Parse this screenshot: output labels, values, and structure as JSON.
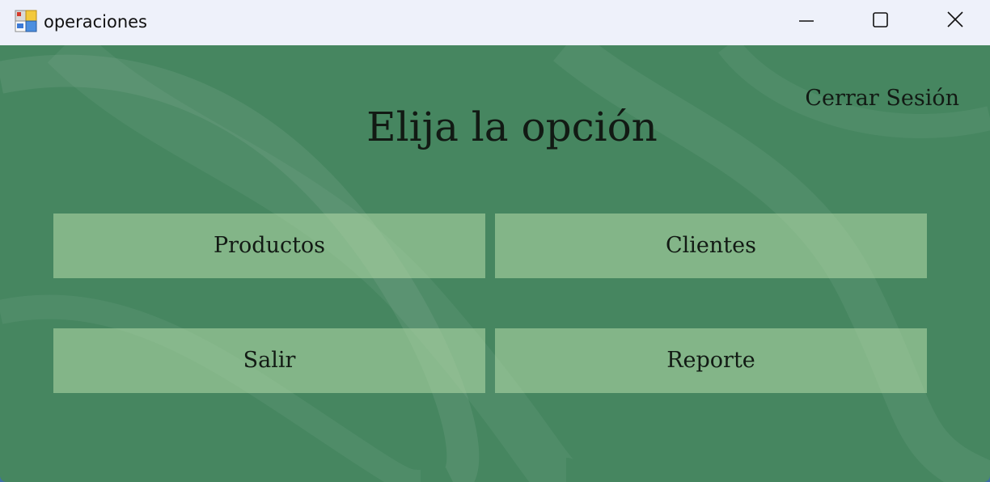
{
  "window": {
    "title": "operaciones",
    "app_icon": "winforms-app-icon",
    "controls": {
      "minimize_icon": "minimize-icon",
      "maximize_icon": "maximize-icon",
      "close_icon": "close-icon"
    }
  },
  "main": {
    "heading": "Elija la opción",
    "logout_link": "Cerrar Sesión",
    "buttons": {
      "productos": "Productos",
      "clientes": "Clientes",
      "salir": "Salir",
      "reporte": "Reporte"
    }
  },
  "colors": {
    "background_green": "#468660",
    "button_fill": "#9bbf96",
    "titlebar": "#eef1fa",
    "text": "#121a14"
  }
}
